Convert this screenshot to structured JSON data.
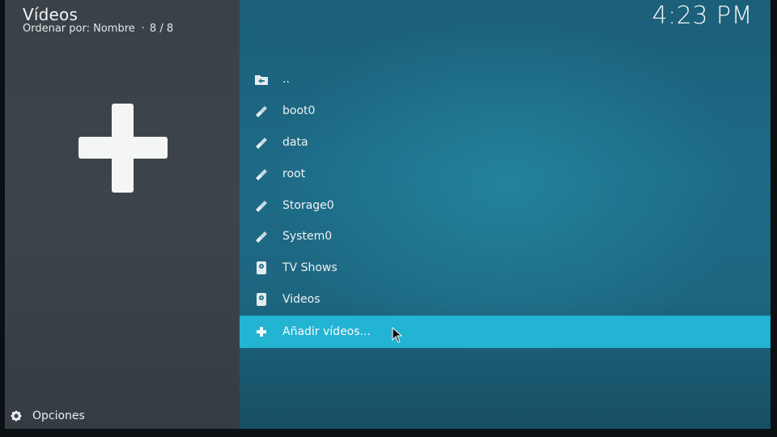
{
  "header": {
    "title": "Vídeos",
    "sort_label": "Ordenar por: Nombre",
    "count": "8 / 8"
  },
  "clock": "4:23 PM",
  "list": {
    "items": [
      {
        "label": "..",
        "icon": "folder-back-icon"
      },
      {
        "label": "boot0",
        "icon": "usb-icon"
      },
      {
        "label": "data",
        "icon": "usb-icon"
      },
      {
        "label": "root",
        "icon": "usb-icon"
      },
      {
        "label": "Storage0",
        "icon": "usb-icon"
      },
      {
        "label": "System0",
        "icon": "usb-icon"
      },
      {
        "label": "TV Shows",
        "icon": "hard-drive-icon"
      },
      {
        "label": "Videos",
        "icon": "hard-drive-icon"
      },
      {
        "label": "Añadir vídeos...",
        "icon": "plus-icon",
        "selected": true
      }
    ]
  },
  "footer": {
    "options_label": "Opciones"
  },
  "colors": {
    "accent": "#23b3d3",
    "left_panel": "#3b4349",
    "background": "#1d6a86"
  }
}
